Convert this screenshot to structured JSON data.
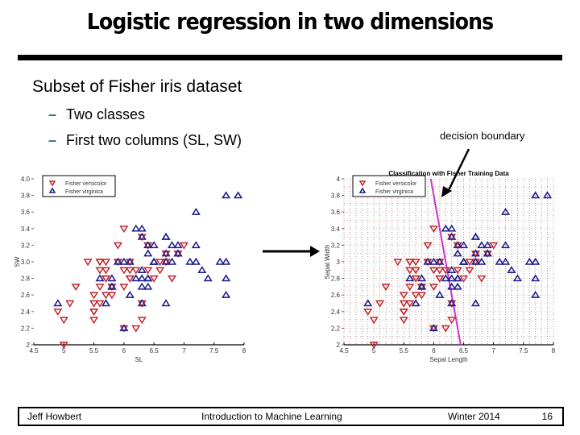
{
  "slide": {
    "title": "Logistic regression in two dimensions",
    "heading": "Subset of Fisher iris dataset",
    "bullets": [
      {
        "marker": "–",
        "text": "Two classes"
      },
      {
        "marker": "–",
        "text": "First two columns (SL, SW)"
      }
    ],
    "annotation": "decision boundary",
    "footer": {
      "author": "Jeff Howbert",
      "course": "Introduction to Machine Learning",
      "term": "Winter 2014",
      "page": "16"
    }
  },
  "colors": {
    "versicolor": "#c0272d",
    "virginica": "#1a1a8c",
    "boundary": "#cc33cc",
    "grid": "#c0272d"
  },
  "chart_data": [
    {
      "type": "scatter",
      "title": "",
      "xlabel": "SL",
      "ylabel": "SW",
      "xlim": [
        4.5,
        8
      ],
      "ylim": [
        2,
        4
      ],
      "xticks": [
        "4.5",
        "5",
        "5.5",
        "6",
        "6.5",
        "7",
        "7.5",
        "8"
      ],
      "yticks": [
        "2",
        "2.2",
        "2.4",
        "2.6",
        "2.8",
        "3.0",
        "3.2",
        "3.4",
        "3.6",
        "3.8",
        "4.0"
      ],
      "legend": {
        "position": "top-left",
        "entries": [
          "Fisher versicolor",
          "Fisher virginica"
        ]
      },
      "grid": false,
      "series": [
        {
          "name": "Fisher versicolor",
          "marker": "triangle-down",
          "points": [
            [
              7.0,
              3.2
            ],
            [
              6.4,
              3.2
            ],
            [
              6.9,
              3.1
            ],
            [
              5.5,
              2.3
            ],
            [
              6.5,
              2.8
            ],
            [
              5.7,
              2.8
            ],
            [
              6.3,
              3.3
            ],
            [
              4.9,
              2.4
            ],
            [
              6.6,
              2.9
            ],
            [
              5.2,
              2.7
            ],
            [
              5.0,
              2.0
            ],
            [
              5.9,
              3.0
            ],
            [
              6.0,
              2.2
            ],
            [
              6.1,
              2.9
            ],
            [
              5.6,
              2.9
            ],
            [
              6.7,
              3.1
            ],
            [
              5.6,
              3.0
            ],
            [
              5.8,
              2.7
            ],
            [
              6.2,
              2.2
            ],
            [
              5.6,
              2.5
            ],
            [
              5.9,
              3.2
            ],
            [
              6.1,
              2.8
            ],
            [
              6.3,
              2.5
            ],
            [
              6.1,
              2.8
            ],
            [
              6.4,
              2.9
            ],
            [
              6.6,
              3.0
            ],
            [
              6.8,
              2.8
            ],
            [
              6.7,
              3.0
            ],
            [
              6.0,
              2.9
            ],
            [
              5.7,
              2.6
            ],
            [
              5.5,
              2.4
            ],
            [
              5.5,
              2.4
            ],
            [
              5.8,
              2.7
            ],
            [
              6.0,
              2.7
            ],
            [
              5.4,
              3.0
            ],
            [
              6.0,
              3.4
            ],
            [
              6.7,
              3.1
            ],
            [
              6.3,
              2.3
            ],
            [
              5.6,
              3.0
            ],
            [
              5.5,
              2.5
            ],
            [
              5.5,
              2.6
            ],
            [
              6.1,
              3.0
            ],
            [
              5.8,
              2.6
            ],
            [
              5.0,
              2.3
            ],
            [
              5.6,
              2.7
            ],
            [
              5.7,
              3.0
            ],
            [
              5.7,
              2.9
            ],
            [
              6.2,
              2.9
            ],
            [
              5.1,
              2.5
            ],
            [
              5.7,
              2.8
            ]
          ]
        },
        {
          "name": "Fisher virginica",
          "marker": "triangle-up",
          "points": [
            [
              6.3,
              3.3
            ],
            [
              5.8,
              2.7
            ],
            [
              7.1,
              3.0
            ],
            [
              6.3,
              2.9
            ],
            [
              6.5,
              3.0
            ],
            [
              7.6,
              3.0
            ],
            [
              4.9,
              2.5
            ],
            [
              7.3,
              2.9
            ],
            [
              6.7,
              2.5
            ],
            [
              7.2,
              3.6
            ],
            [
              6.5,
              3.2
            ],
            [
              6.4,
              2.7
            ],
            [
              6.8,
              3.0
            ],
            [
              5.7,
              2.5
            ],
            [
              5.8,
              2.8
            ],
            [
              6.4,
              3.2
            ],
            [
              6.5,
              3.0
            ],
            [
              7.7,
              3.8
            ],
            [
              7.7,
              2.6
            ],
            [
              6.0,
              2.2
            ],
            [
              6.9,
              3.2
            ],
            [
              5.6,
              2.8
            ],
            [
              7.7,
              2.8
            ],
            [
              6.3,
              2.7
            ],
            [
              6.7,
              3.3
            ],
            [
              7.2,
              3.2
            ],
            [
              6.2,
              2.8
            ],
            [
              6.1,
              3.0
            ],
            [
              6.4,
              2.8
            ],
            [
              7.2,
              3.0
            ],
            [
              7.4,
              2.8
            ],
            [
              7.9,
              3.8
            ],
            [
              6.4,
              2.8
            ],
            [
              6.3,
              2.8
            ],
            [
              6.1,
              2.6
            ],
            [
              7.7,
              3.0
            ],
            [
              6.3,
              3.4
            ],
            [
              6.4,
              3.1
            ],
            [
              6.0,
              3.0
            ],
            [
              6.9,
              3.1
            ],
            [
              6.7,
              3.1
            ],
            [
              6.9,
              3.1
            ],
            [
              5.8,
              2.7
            ],
            [
              6.8,
              3.2
            ],
            [
              6.7,
              3.3
            ],
            [
              6.7,
              3.0
            ],
            [
              6.3,
              2.5
            ],
            [
              6.5,
              3.0
            ],
            [
              6.2,
              3.4
            ],
            [
              5.9,
              3.0
            ]
          ]
        }
      ]
    },
    {
      "type": "scatter",
      "title": "Classification with Fisher Training Data",
      "xlabel": "Sepal Length",
      "ylabel": "Sepal Width",
      "xlim": [
        4.5,
        8
      ],
      "ylim": [
        2,
        4
      ],
      "xticks": [
        "4.5",
        "5",
        "5.5",
        "6",
        "6.5",
        "7",
        "7.5",
        "8"
      ],
      "yticks": [
        "2",
        "2.2",
        "2.4",
        "2.6",
        "2.8",
        "3",
        "3.2",
        "3.4",
        "3.6",
        "3.8",
        "4"
      ],
      "legend": {
        "position": "top-left",
        "entries": [
          "Fisher versicolor",
          "Fisher virginica"
        ]
      },
      "grid": true,
      "decision_boundary": {
        "label": "decision boundary",
        "points": [
          [
            5.95,
            4.0
          ],
          [
            6.45,
            2.0
          ]
        ]
      },
      "series_ref": "same points as first chart"
    }
  ]
}
